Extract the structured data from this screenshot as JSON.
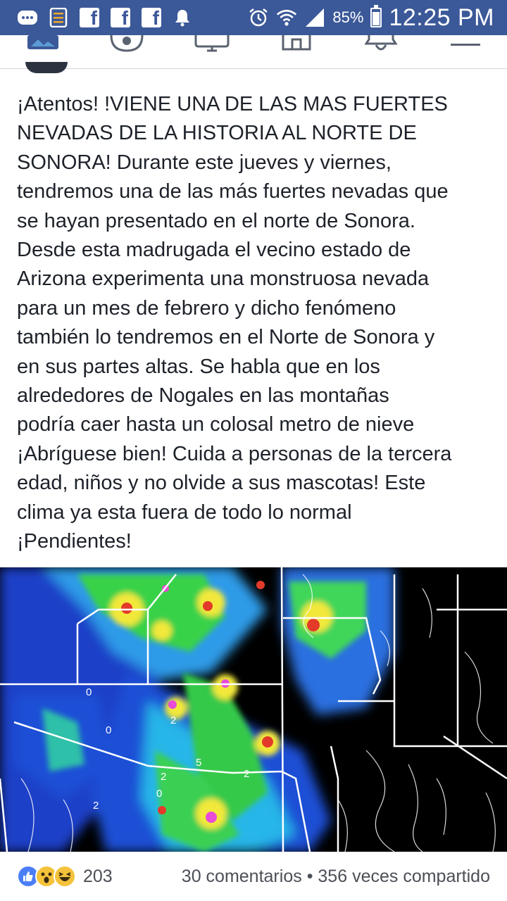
{
  "status_bar": {
    "battery_percent": "85%",
    "time": "12:25 PM",
    "icons": [
      "messenger-icon",
      "notes-icon",
      "facebook-icon",
      "facebook-icon",
      "facebook-icon",
      "notification-bell-icon",
      "alarm-icon",
      "wifi-icon",
      "signal-icon",
      "battery-icon"
    ]
  },
  "nav_bar": {
    "icons": [
      "news-feed-icon",
      "friends-icon",
      "watch-icon",
      "marketplace-icon",
      "notifications-icon",
      "menu-icon"
    ]
  },
  "post": {
    "text_lines": [
      "¡Atentos! !VIENE UNA DE LAS MAS FUERTES",
      "NEVADAS DE LA HISTORIA AL NORTE DE",
      "SONORA! Durante este jueves y viernes,",
      "tendremos una de las más fuertes nevadas que",
      "se hayan presentado en el norte de Sonora.",
      "Desde esta madrugada el vecino estado de",
      "Arizona experimenta una monstruosa nevada",
      "para un mes de febrero y dicho fenómeno",
      "también lo tendremos en el Norte de Sonora y",
      "en sus partes altas. Se habla que en los",
      "alrededores de Nogales en las montañas",
      "podría caer hasta un colosal metro de nieve",
      "¡Abríguese bien! Cuida a personas de la tercera",
      "edad, niños y no olvide a sus mascotas! Este",
      "clima ya esta fuera de todo lo normal",
      "¡Pendientes!"
    ],
    "image": {
      "kind": "weather-radar-map",
      "map_labels": [
        "0",
        "0",
        "2",
        "0",
        "2",
        "5",
        "2",
        "2"
      ]
    }
  },
  "footer": {
    "reaction_icons": [
      "like-icon",
      "wow-icon",
      "haha-icon"
    ],
    "reaction_count": "203",
    "comments": "30 comentarios",
    "separator": "•",
    "shares": "356 veces compartido"
  },
  "colors": {
    "facebook_blue": "#3b5898",
    "text": "#1d2129",
    "secondary_text": "#4b4f56",
    "like_blue": "#4b7ef6",
    "emoji_yellow": "#f5c33b"
  }
}
